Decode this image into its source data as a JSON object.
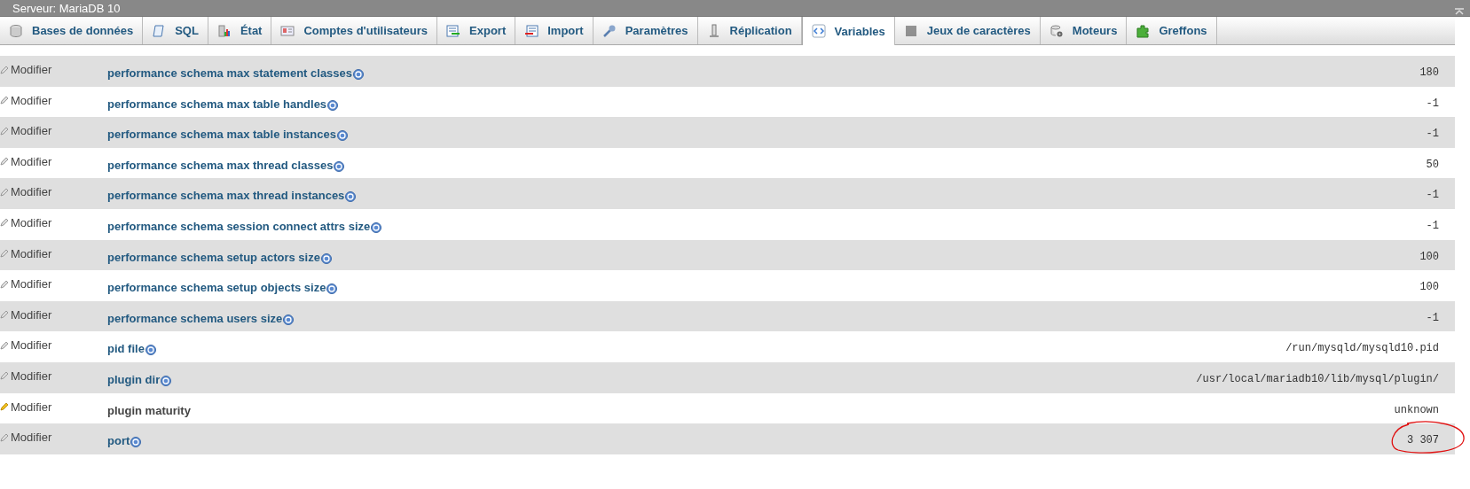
{
  "window": {
    "title": "Serveur: MariaDB 10"
  },
  "tabs": [
    {
      "label": "Bases de données",
      "selected": false
    },
    {
      "label": "SQL",
      "selected": false
    },
    {
      "label": "État",
      "selected": false
    },
    {
      "label": "Comptes d'utilisateurs",
      "selected": false
    },
    {
      "label": "Export",
      "selected": false
    },
    {
      "label": "Import",
      "selected": false
    },
    {
      "label": "Paramètres",
      "selected": false
    },
    {
      "label": "Réplication",
      "selected": false
    },
    {
      "label": "Variables",
      "selected": true
    },
    {
      "label": "Jeux de caractères",
      "selected": false
    },
    {
      "label": "Moteurs",
      "selected": false
    },
    {
      "label": "Greffons",
      "selected": false
    }
  ],
  "variables": [
    {
      "action": "Modifier",
      "name": "performance schema max statement classes",
      "help": true,
      "highlighted": false,
      "value": "180",
      "circled": false
    },
    {
      "action": "Modifier",
      "name": "performance schema max table handles",
      "help": true,
      "highlighted": false,
      "value": "-1",
      "circled": false
    },
    {
      "action": "Modifier",
      "name": "performance schema max table instances",
      "help": true,
      "highlighted": false,
      "value": "-1",
      "circled": false
    },
    {
      "action": "Modifier",
      "name": "performance schema max thread classes",
      "help": true,
      "highlighted": false,
      "value": "50",
      "circled": false
    },
    {
      "action": "Modifier",
      "name": "performance schema max thread instances",
      "help": true,
      "highlighted": false,
      "value": "-1",
      "circled": false
    },
    {
      "action": "Modifier",
      "name": "performance schema session connect attrs size",
      "help": true,
      "highlighted": false,
      "value": "-1",
      "circled": false
    },
    {
      "action": "Modifier",
      "name": "performance schema setup actors size",
      "help": true,
      "highlighted": false,
      "value": "100",
      "circled": false
    },
    {
      "action": "Modifier",
      "name": "performance schema setup objects size",
      "help": true,
      "highlighted": false,
      "value": "100",
      "circled": false
    },
    {
      "action": "Modifier",
      "name": "performance schema users size",
      "help": true,
      "highlighted": false,
      "value": "-1",
      "circled": false
    },
    {
      "action": "Modifier",
      "name": "pid file",
      "help": true,
      "highlighted": false,
      "value": "/run/mysqld/mysqld10.pid",
      "circled": false
    },
    {
      "action": "Modifier",
      "name": "plugin dir",
      "help": true,
      "highlighted": false,
      "value": "/usr/local/mariadb10/lib/mysql/plugin/",
      "circled": false
    },
    {
      "action": "Modifier",
      "name": "plugin maturity",
      "help": false,
      "highlighted": true,
      "value": "unknown",
      "circled": false
    },
    {
      "action": "Modifier",
      "name": "port",
      "help": true,
      "highlighted": false,
      "value": "3 307",
      "circled": true
    }
  ]
}
